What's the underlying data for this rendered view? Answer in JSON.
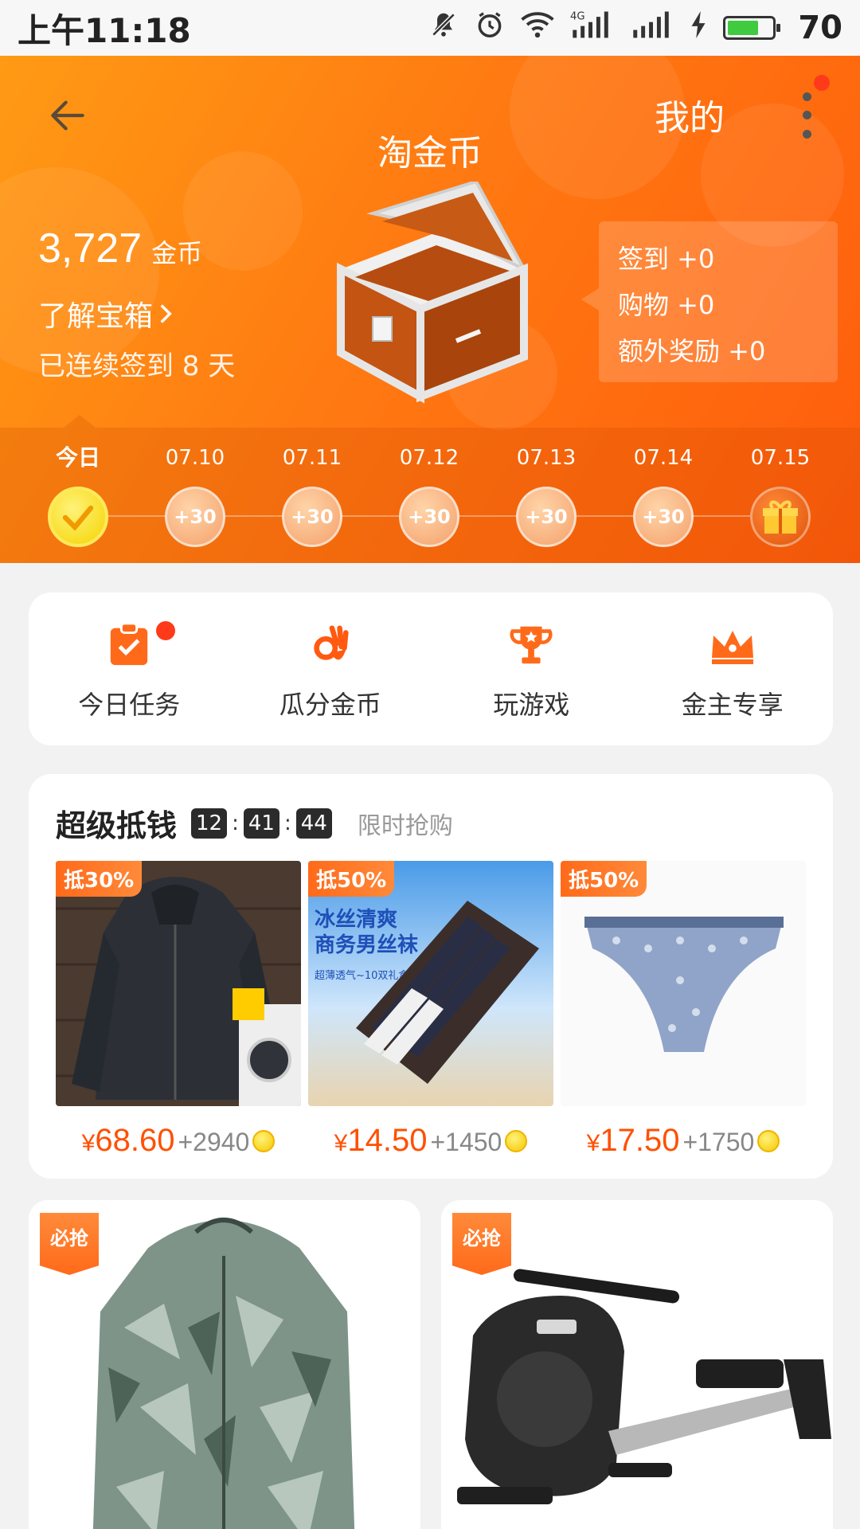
{
  "status_bar": {
    "time": "上午11:18",
    "battery_percent": "70",
    "battery_level": 0.7,
    "network_label": "4G"
  },
  "header": {
    "title": "淘金币",
    "mine_label": "我的"
  },
  "coins": {
    "value": "3,727",
    "unit": "金币",
    "learn_chest": "了解宝箱",
    "streak": "已连续签到 8 天"
  },
  "reward": {
    "checkin": "签到 +0",
    "shopping": "购物 +0",
    "extra": "额外奖励 +0"
  },
  "timeline": {
    "days": [
      {
        "date": "今日",
        "coin": "✓"
      },
      {
        "date": "07.10",
        "coin": "+30"
      },
      {
        "date": "07.11",
        "coin": "+30"
      },
      {
        "date": "07.12",
        "coin": "+30"
      },
      {
        "date": "07.13",
        "coin": "+30"
      },
      {
        "date": "07.14",
        "coin": "+30"
      },
      {
        "date": "07.15",
        "coin": "gift"
      }
    ]
  },
  "actions": [
    {
      "label": "今日任务",
      "icon": "task-clipboard-icon"
    },
    {
      "label": "瓜分金币",
      "icon": "ok-hand-icon"
    },
    {
      "label": "玩游戏",
      "icon": "trophy-icon"
    },
    {
      "label": "金主专享",
      "icon": "crown-icon"
    }
  ],
  "deals": {
    "title": "超级抵钱",
    "countdown": [
      "12",
      "41",
      "44"
    ],
    "subtitle": "限时抢购",
    "products": [
      {
        "tag": "抵30%",
        "price": "68.60",
        "coins": "+2940",
        "image": "jacket-image"
      },
      {
        "tag": "抵50%",
        "price": "14.50",
        "coins": "+1450",
        "image": "socks-image",
        "image_text": [
          "冰丝清爽",
          "商务男丝袜",
          "超薄透气~10双礼盒"
        ]
      },
      {
        "tag": "抵50%",
        "price": "17.50",
        "coins": "+1750",
        "image": "briefs-image"
      }
    ],
    "currency": "¥"
  },
  "grid": [
    {
      "tag": "必抢",
      "image": "camo-jacket-image"
    },
    {
      "tag": "必抢",
      "image": "rowing-machine-image"
    }
  ],
  "colors": {
    "accent": "#ff5000",
    "banner_start": "#ff9a14",
    "banner_end": "#ff5c0c"
  }
}
